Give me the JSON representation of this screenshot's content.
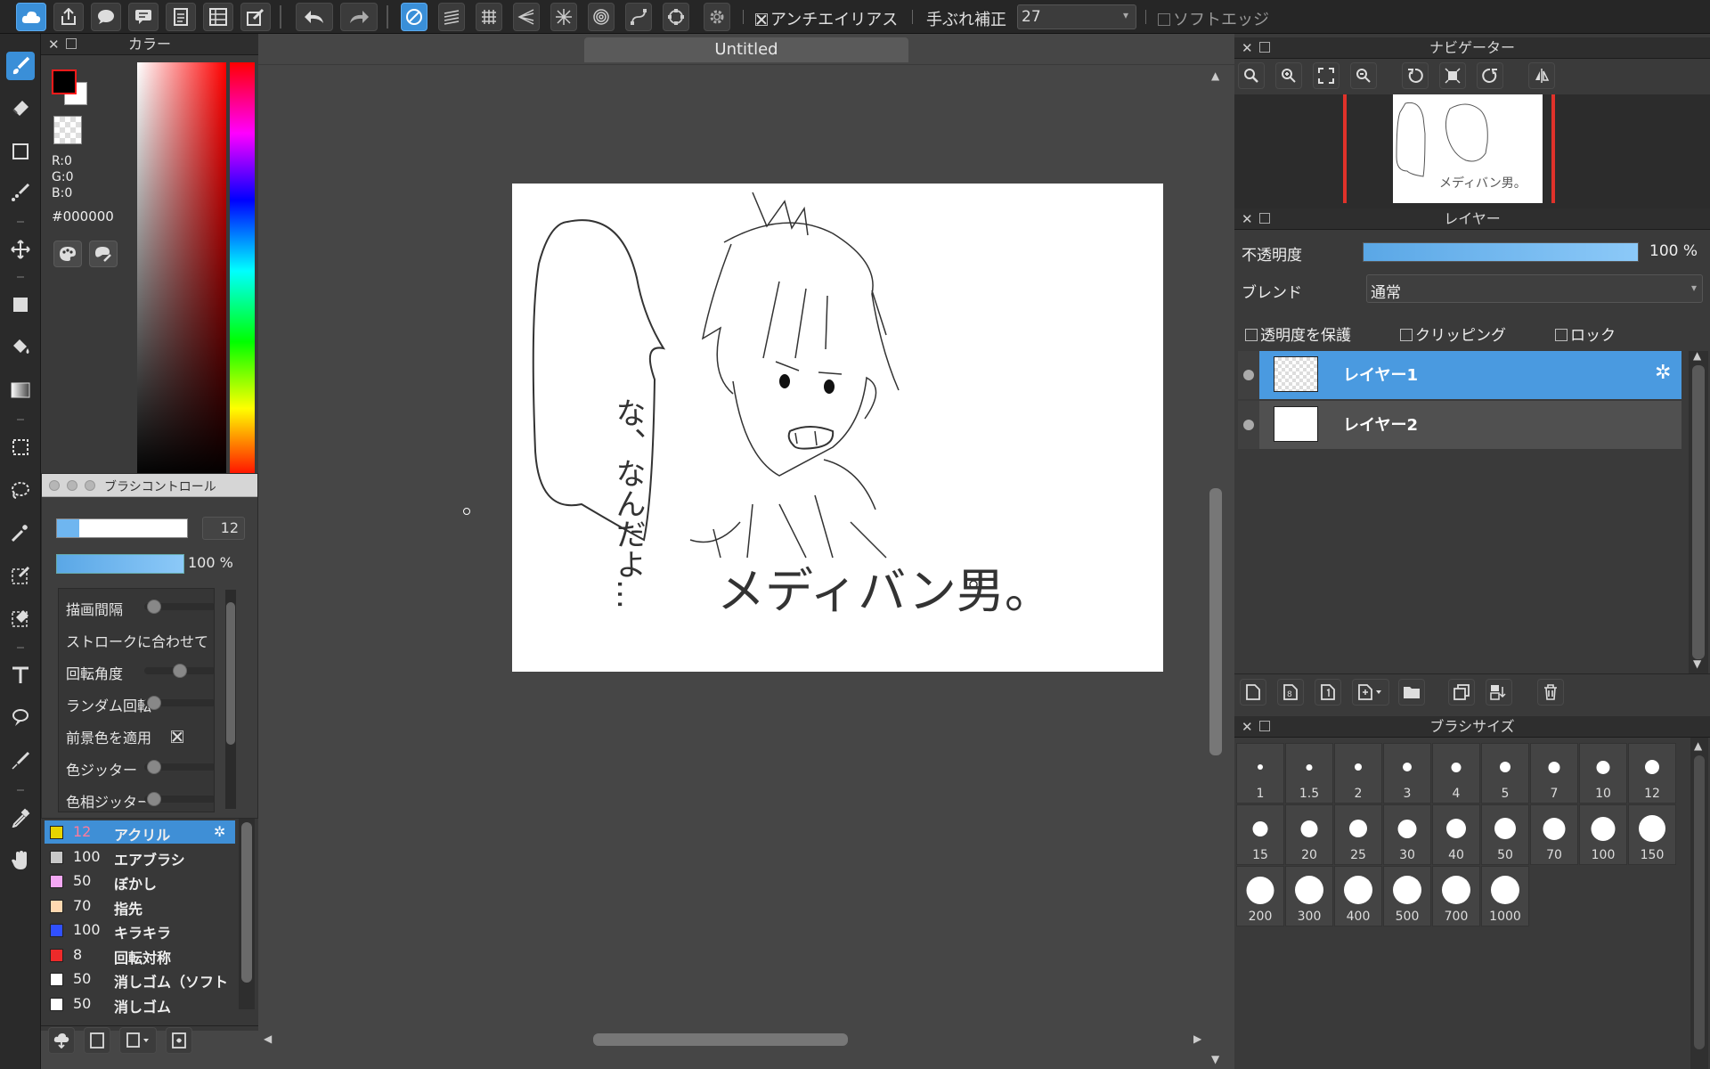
{
  "toolbar": {
    "antialias_label": "アンチエイリアス",
    "stabilizer_label": "手ぶれ補正",
    "stabilizer_value": "27",
    "soft_edge_label": "ソフトエッジ",
    "antialias_checked": true,
    "soft_edge_checked": false
  },
  "document": {
    "title": "Untitled"
  },
  "color_panel": {
    "title": "カラー",
    "r": "R:0",
    "g": "G:0",
    "b": "B:0",
    "hex": "#000000",
    "foreground": "#000000",
    "background": "#ffffff"
  },
  "brush_control": {
    "title": "ブラシコントロール",
    "size_value": "12",
    "opacity_value": "100 %",
    "settings": [
      {
        "label": "描画間隔",
        "level": 0.05
      },
      {
        "label": "ストロークに合わせて",
        "level": null
      },
      {
        "label": "回転角度",
        "level": 0.5
      },
      {
        "label": "ランダム回転",
        "level": 0.05
      },
      {
        "label": "前景色を適用",
        "checked": true
      },
      {
        "label": "色ジッター",
        "level": 0.05
      },
      {
        "label": "色相ジッター",
        "level": 0.05
      }
    ]
  },
  "brush_list": [
    {
      "size": "12",
      "name": "アクリル",
      "color": "#e8d400",
      "selected": true
    },
    {
      "size": "100",
      "name": "エアブラシ",
      "color": "#c8c8c8"
    },
    {
      "size": "50",
      "name": "ぼかし",
      "color": "#f4a8f4"
    },
    {
      "size": "70",
      "name": "指先",
      "color": "#ffd8b0"
    },
    {
      "size": "100",
      "name": "キラキラ",
      "color": "#3050ff"
    },
    {
      "size": "8",
      "name": "回転対称",
      "color": "#ee2a2a"
    },
    {
      "size": "50",
      "name": "消しゴム（ソフト",
      "color": "#ffffff"
    },
    {
      "size": "50",
      "name": "消しゴム",
      "color": "#ffffff"
    }
  ],
  "artwork": {
    "speech_text": "な、なんだよ…",
    "caption_text": "メディバン男。"
  },
  "navigator": {
    "title": "ナビゲーター"
  },
  "layers_panel": {
    "title": "レイヤー",
    "opacity_label": "不透明度",
    "opacity_value": "100 %",
    "opacity_level": 1.0,
    "blend_label": "ブレンド",
    "blend_value": "通常",
    "protect_alpha_label": "透明度を保護",
    "clipping_label": "クリッピング",
    "lock_label": "ロック",
    "layers": [
      {
        "name": "レイヤー1",
        "selected": true
      },
      {
        "name": "レイヤー2",
        "selected": false
      }
    ]
  },
  "brush_size_panel": {
    "title": "ブラシサイズ",
    "sizes": [
      "1",
      "1.5",
      "2",
      "3",
      "4",
      "5",
      "7",
      "10",
      "12",
      "15",
      "20",
      "25",
      "30",
      "40",
      "50",
      "70",
      "100",
      "150",
      "200",
      "300",
      "400",
      "500",
      "700",
      "1000"
    ]
  }
}
